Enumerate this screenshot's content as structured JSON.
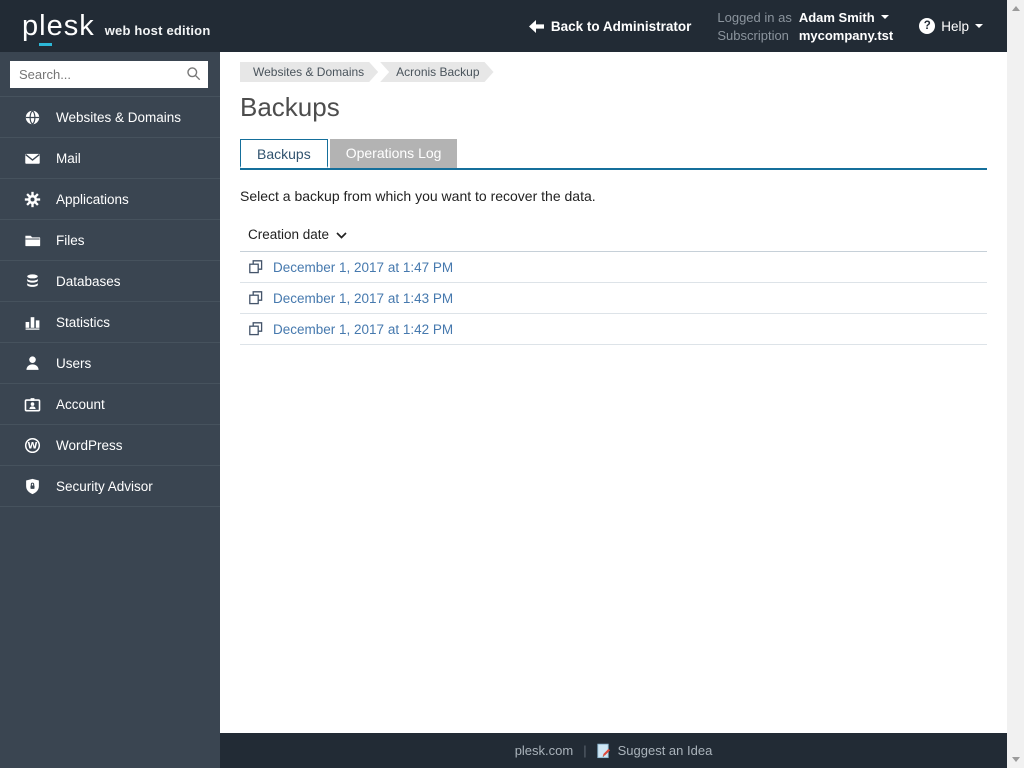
{
  "header": {
    "logo": "plesk",
    "edition": "web host edition",
    "back_label": "Back to Administrator",
    "logged_in_label": "Logged in as",
    "logged_in_user": "Adam Smith",
    "subscription_label": "Subscription",
    "subscription_value": "mycompany.tst",
    "help_label": "Help",
    "help_glyph": "?"
  },
  "sidebar": {
    "search_placeholder": "Search...",
    "items": [
      {
        "label": "Websites & Domains",
        "icon": "globe-icon"
      },
      {
        "label": "Mail",
        "icon": "mail-icon"
      },
      {
        "label": "Applications",
        "icon": "gear-icon"
      },
      {
        "label": "Files",
        "icon": "folder-icon"
      },
      {
        "label": "Databases",
        "icon": "database-icon"
      },
      {
        "label": "Statistics",
        "icon": "bar-chart-icon"
      },
      {
        "label": "Users",
        "icon": "user-icon"
      },
      {
        "label": "Account",
        "icon": "id-card-icon"
      },
      {
        "label": "WordPress",
        "icon": "wordpress-icon"
      },
      {
        "label": "Security Advisor",
        "icon": "shield-lock-icon"
      }
    ]
  },
  "main": {
    "breadcrumbs": [
      "Websites & Domains",
      "Acronis Backup"
    ],
    "title": "Backups",
    "tabs": [
      {
        "label": "Backups",
        "active": true
      },
      {
        "label": "Operations Log",
        "active": false
      }
    ],
    "description": "Select a backup from which you want to recover the data.",
    "table": {
      "sort_column": "Creation date",
      "rows": [
        "December 1, 2017 at 1:47 PM",
        "December 1, 2017 at 1:43 PM",
        "December 1, 2017 at 1:42 PM"
      ]
    }
  },
  "footer": {
    "link_plesk": "plesk.com",
    "separator": "|",
    "link_idea": "Suggest an Idea"
  },
  "colors": {
    "header_bg": "#222b35",
    "sidebar_bg": "#3a4551",
    "footer_bg": "#222b35",
    "brand_cyan": "#2cb8d8",
    "link_blue": "#4679ae",
    "tab_accent": "#156f9b",
    "inactive_tab_bg": "#b3b3b3",
    "breadcrumb_bg": "#e7e7e7"
  }
}
